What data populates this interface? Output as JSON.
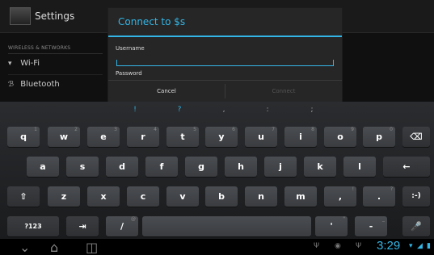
{
  "settings": {
    "title": "Settings",
    "section": "WIRELESS & NETWORKS",
    "items": [
      {
        "label": "Wi-Fi",
        "icon": "wifi-icon"
      },
      {
        "label": "Bluetooth",
        "icon": "bluetooth-icon"
      }
    ]
  },
  "dialog": {
    "title": "Connect to $s",
    "username_label": "Username",
    "username_value": "",
    "password_label": "Password",
    "cancel": "Cancel",
    "connect": "Connect"
  },
  "keyboard": {
    "suggestions": [
      "!",
      "?",
      ",",
      ":",
      ";"
    ],
    "row1": [
      "q",
      "w",
      "e",
      "r",
      "t",
      "y",
      "u",
      "i",
      "o",
      "p"
    ],
    "row1_hints": [
      "1",
      "2",
      "3",
      "4",
      "5",
      "6",
      "7",
      "8",
      "9",
      "0"
    ],
    "row2": [
      "a",
      "s",
      "d",
      "f",
      "g",
      "h",
      "j",
      "k",
      "l"
    ],
    "row3": [
      "z",
      "x",
      "c",
      "v",
      "b",
      "n",
      "m"
    ],
    "comma": ",",
    "comma_hint": "!",
    "period": ".",
    "period_hint": "?",
    "smiley": ":-)",
    "symbols": "?123",
    "slash": "/",
    "slash_hint": "@",
    "apostrophe": "'",
    "apostrophe_hint": "\"",
    "dash": "-",
    "dash_hint": "_"
  },
  "status": {
    "clock": "3:29"
  },
  "colors": {
    "accent": "#33b5e5",
    "key": "#43464a",
    "background": "#000000"
  }
}
